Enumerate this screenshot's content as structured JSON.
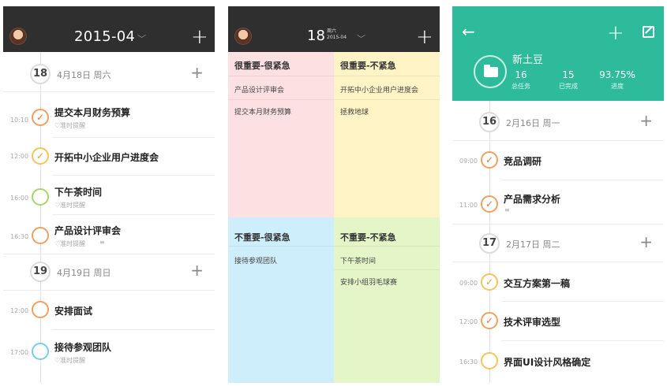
{
  "screen1": {
    "month": "2015-04",
    "days": [
      {
        "day": "18",
        "label": "4月18日 周六",
        "tasks": [
          {
            "time": "10:10",
            "title": "提交本月财务预算",
            "remind": "准时提醒",
            "status": "done",
            "color": "orange"
          },
          {
            "time": "12:00",
            "title": "开拓中小企业用户进度会",
            "remind": "",
            "status": "done",
            "color": "gold"
          },
          {
            "time": "16:00",
            "title": "下午茶时间",
            "remind": "准时提醒",
            "status": "open",
            "color": "green"
          },
          {
            "time": "16:30",
            "title": "产品设计评审会",
            "remind": "准时提醒",
            "status": "open",
            "color": "orange"
          }
        ]
      },
      {
        "day": "19",
        "label": "4月19日 周日",
        "tasks": [
          {
            "time": "12:00",
            "title": "安排面试",
            "remind": "",
            "status": "open",
            "color": "orange"
          },
          {
            "time": "17:00",
            "title": "接待参观团队",
            "remind": "准时提醒",
            "status": "open",
            "color": "blue"
          }
        ]
      }
    ]
  },
  "screen2": {
    "day": "18",
    "weekday": "周六",
    "month": "2015-04",
    "quadrants": [
      {
        "title": "很重要-很紧急",
        "color": "#fde0e2",
        "items": [
          "产品设计评审会",
          "提交本月财务预算"
        ]
      },
      {
        "title": "很重要-不紧急",
        "color": "#fff4c6",
        "items": [
          "开拓中小企业用户进度会",
          "拯救地球"
        ]
      },
      {
        "title": "不重要-很紧急",
        "color": "#cfeefb",
        "items": [
          "接待参观团队"
        ]
      },
      {
        "title": "不重要-不紧急",
        "color": "#e4f5c8",
        "items": [
          "下午茶时间",
          "安排小组羽毛球赛"
        ]
      }
    ]
  },
  "screen3": {
    "project_name": "新土豆",
    "stats": [
      {
        "value": "16",
        "label": "总任务"
      },
      {
        "value": "15",
        "label": "已完成"
      },
      {
        "value": "93.75%",
        "label": "进度"
      }
    ],
    "days": [
      {
        "day": "16",
        "label": "2月16日 周一",
        "tasks": [
          {
            "time": "09:00",
            "title": "竞品调研",
            "status": "done",
            "color": "orange"
          },
          {
            "time": "11:00",
            "title": "产品需求分析",
            "status": "done",
            "color": "orange"
          }
        ]
      },
      {
        "day": "17",
        "label": "2月17日 周二",
        "tasks": [
          {
            "time": "09:00",
            "title": "交互方案第一稿",
            "status": "done",
            "color": "gold"
          },
          {
            "time": "12:00",
            "title": "技术评审选型",
            "status": "done",
            "color": "orange"
          },
          {
            "time": "16:30",
            "title": "界面UI设计风格确定",
            "status": "open",
            "color": "gold"
          }
        ]
      }
    ]
  },
  "icons": {
    "check": "✓",
    "plus": "+",
    "back": "←",
    "chevron": "﹀",
    "bell": "♡",
    "notes": "≡"
  },
  "colors": {
    "teal": "#2dbb9b",
    "dark_header": "#2f2f2f",
    "orange": "#f07040",
    "gold": "#f0a030",
    "green": "#a7d66d",
    "blue": "#7fcbf0"
  }
}
